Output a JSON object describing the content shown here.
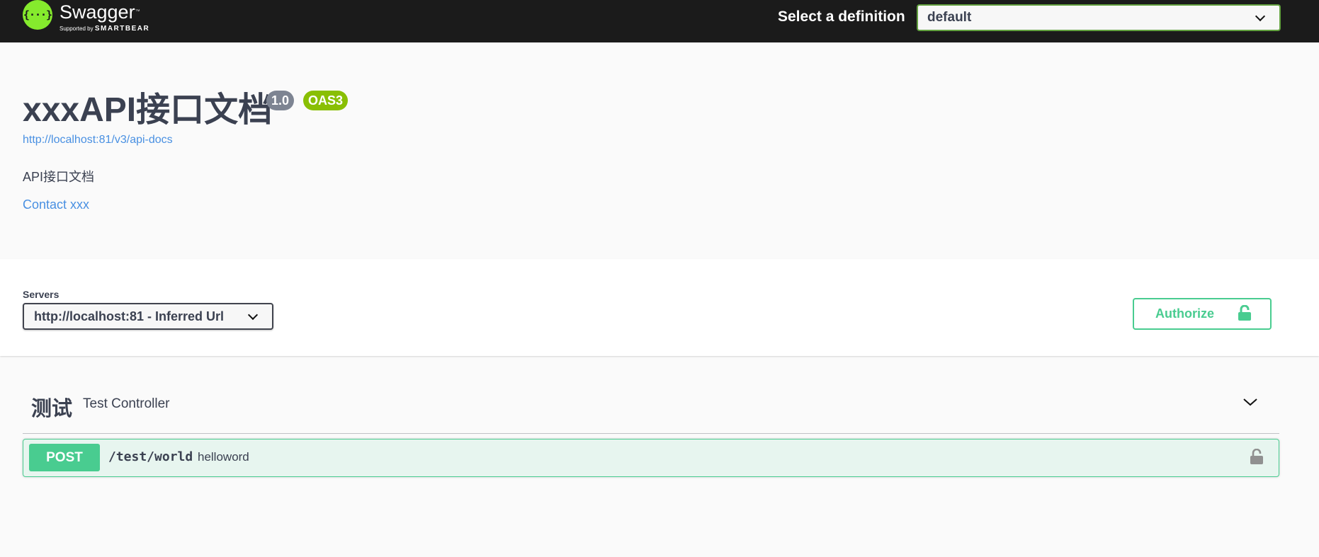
{
  "topbar": {
    "logo_name": "Swagger",
    "logo_supported_by": "Supported by",
    "logo_brand": "SMARTBEAR",
    "logo_glyph": "{···}",
    "definition_label": "Select a definition",
    "definition_selected": "default"
  },
  "info": {
    "title": "xxxAPI接口文档",
    "version_badge": "1.0",
    "oas_badge": "OAS3",
    "spec_url": "http://localhost:81/v3/api-docs",
    "description": "API接口文档",
    "contact": "Contact xxx"
  },
  "servers": {
    "label": "Servers",
    "selected": "http://localhost:81 - Inferred Url"
  },
  "authorize": {
    "label": "Authorize",
    "icon": "unlocked-lock-icon"
  },
  "tags": [
    {
      "name": "测试",
      "description": "Test Controller",
      "expanded": true,
      "operations": [
        {
          "method": "POST",
          "path": "/test/world",
          "summary": "helloword",
          "lock_icon": "unlocked-lock-icon"
        }
      ]
    }
  ],
  "colors": {
    "topbar_bg": "#1b1b1b",
    "logo_green": "#85ea2d",
    "definition_border": "#62a03f",
    "text_primary": "#3b4151",
    "link_blue": "#4990e2",
    "version_badge": "#7d8492",
    "oas_badge": "#89bf04",
    "post_green": "#49cc90",
    "authorize_green": "#49cc90"
  }
}
